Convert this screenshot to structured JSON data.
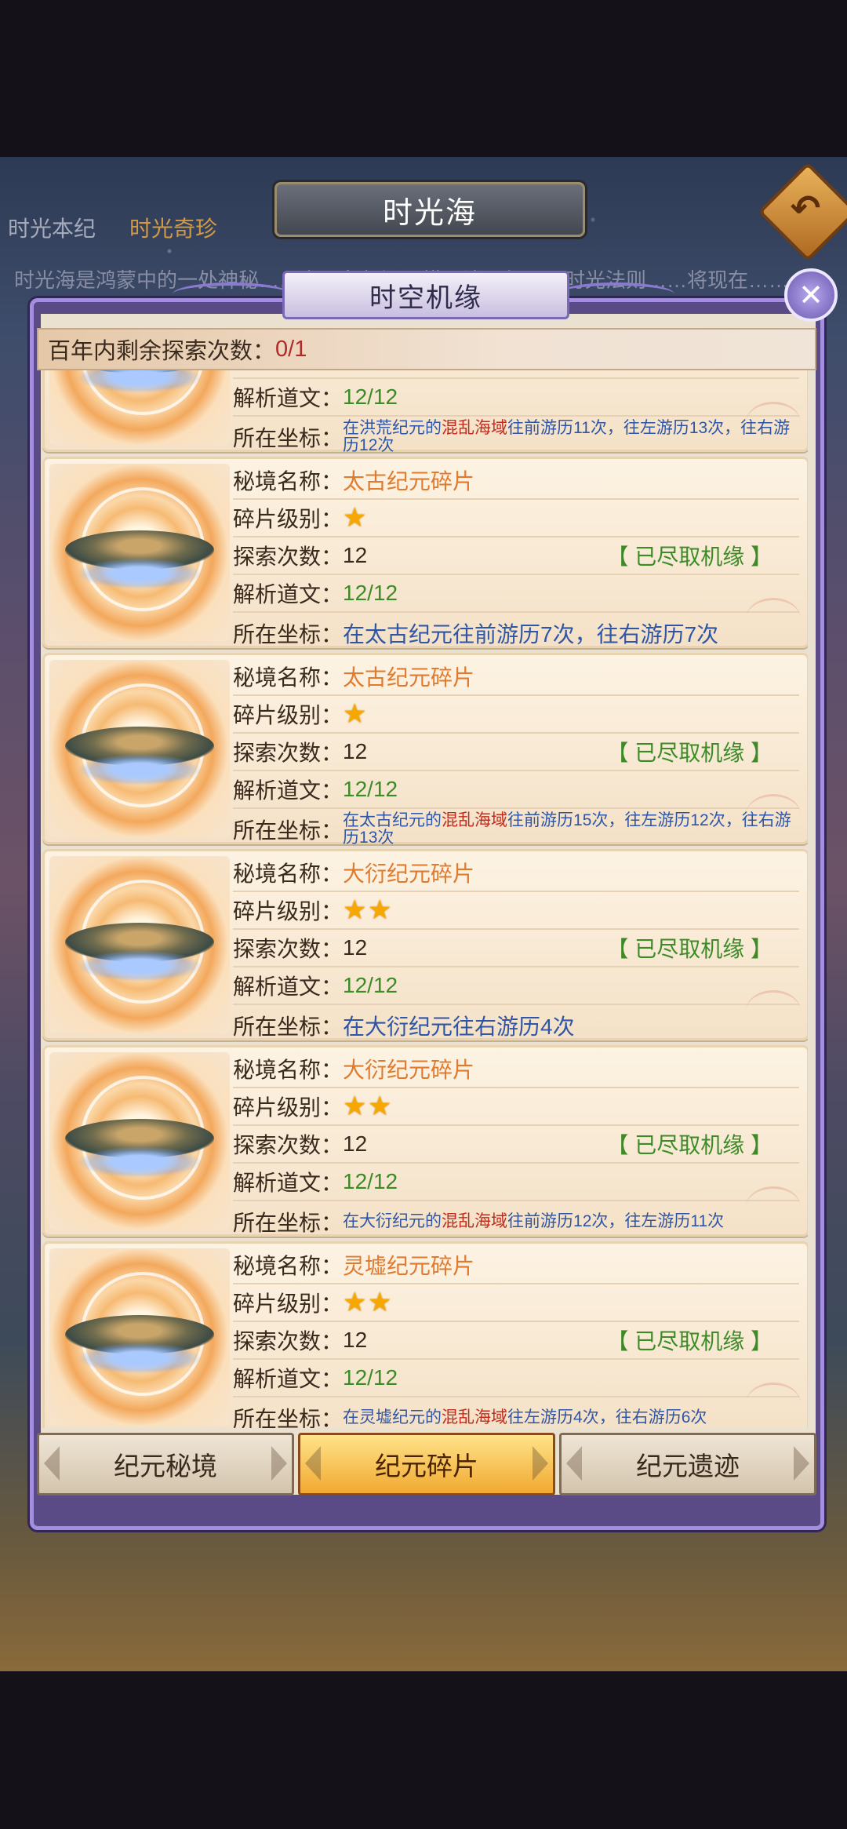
{
  "page": {
    "title": "时光海",
    "nav_tabs": [
      "时光本纪",
      "时光奇珍"
    ],
    "bg_description": "时光海是鸿蒙中的一处神秘……之一鱼起源，横亘诸天纪元，时光法则……将现在……"
  },
  "dialog": {
    "title": "时空机缘",
    "remaining_label": "百年内剩余探索次数：",
    "remaining_value": "0/1",
    "labels": {
      "name": "秘境名称：",
      "level": "碎片级别：",
      "explore": "探索次数：",
      "analysis": "解析道文：",
      "coord": "所在坐标："
    },
    "cards": [
      {
        "name": "",
        "stars": 0,
        "explore": "",
        "status": "",
        "analysis": "12/12",
        "coord_parts": [
          "在洪荒纪元的",
          "混乱海域",
          "往前游历11次，往左游历13次，往右游历12次"
        ],
        "coord_small": true
      },
      {
        "name": "太古纪元碎片",
        "stars": 1,
        "explore": "12",
        "status": "【 已尽取机缘 】",
        "analysis": "12/12",
        "coord_parts": [
          "在太古纪元往前游历7次，往右游历7次"
        ],
        "coord_small": false
      },
      {
        "name": "太古纪元碎片",
        "stars": 1,
        "explore": "12",
        "status": "【 已尽取机缘 】",
        "analysis": "12/12",
        "coord_parts": [
          "在太古纪元的",
          "混乱海域",
          "往前游历15次，往左游历12次，往右游历13次"
        ],
        "coord_small": true
      },
      {
        "name": "大衍纪元碎片",
        "stars": 2,
        "explore": "12",
        "status": "【 已尽取机缘 】",
        "analysis": "12/12",
        "coord_parts": [
          "在大衍纪元往右游历4次"
        ],
        "coord_small": false
      },
      {
        "name": "大衍纪元碎片",
        "stars": 2,
        "explore": "12",
        "status": "【 已尽取机缘 】",
        "analysis": "12/12",
        "coord_parts": [
          "在大衍纪元的",
          "混乱海域",
          "往前游历12次，往左游历11次"
        ],
        "coord_small": true
      },
      {
        "name": "灵墟纪元碎片",
        "stars": 2,
        "explore": "12",
        "status": "【 已尽取机缘 】",
        "analysis": "12/12",
        "coord_parts": [
          "在灵墟纪元的",
          "混乱海域",
          "往左游历4次，往右游历6次"
        ],
        "coord_small": true
      }
    ],
    "tabs": [
      {
        "label": "纪元秘境",
        "active": false
      },
      {
        "label": "纪元碎片",
        "active": true
      },
      {
        "label": "纪元遗迹",
        "active": false
      }
    ]
  },
  "colors": {
    "accent": "#e07a2e",
    "status_green": "#3d8b27",
    "coord_blue": "#2e55a6",
    "highlight_red": "#c22a1e"
  }
}
